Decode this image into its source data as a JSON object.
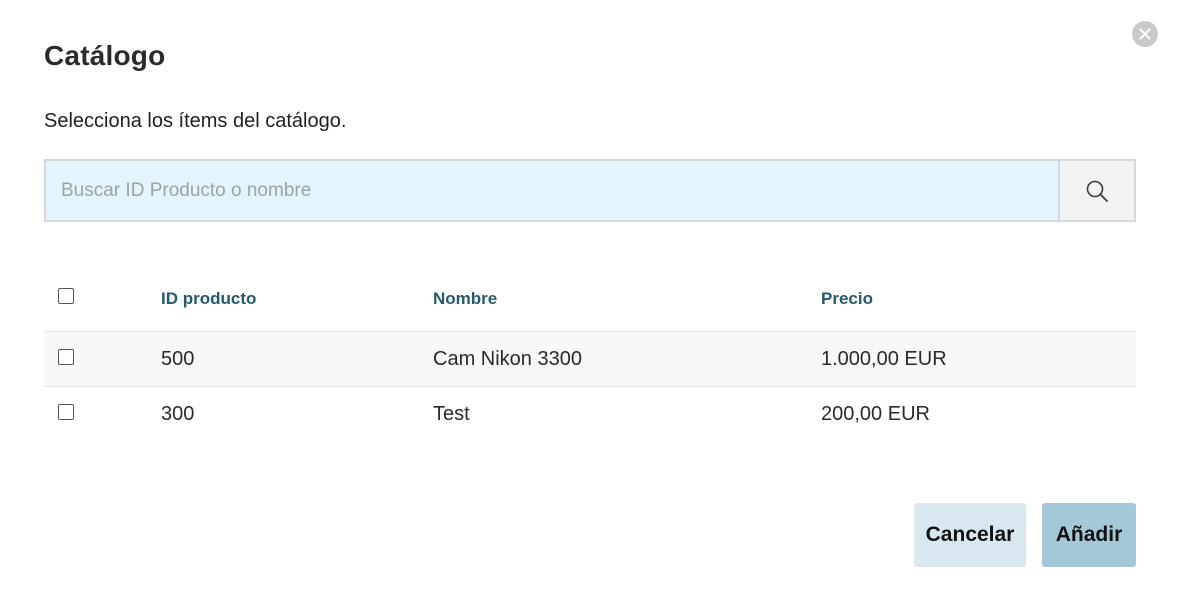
{
  "dialog": {
    "title": "Catálogo",
    "subtitle": "Selecciona los ítems del catálogo."
  },
  "search": {
    "placeholder": "Buscar ID Producto o nombre",
    "value": "",
    "icon": "search-icon"
  },
  "close": {
    "icon": "close-icon"
  },
  "table": {
    "columns": [
      "ID producto",
      "Nombre",
      "Precio"
    ],
    "rows": [
      {
        "id": "500",
        "name": "Cam Nikon 3300",
        "price": "1.000,00 EUR"
      },
      {
        "id": "300",
        "name": "Test",
        "price": "200,00 EUR"
      }
    ]
  },
  "buttons": {
    "cancel": "Cancelar",
    "add": "Añadir"
  },
  "colors": {
    "header_text": "#245a70",
    "search_bg": "#e4f4fc",
    "cancel_bg": "#d9e8ef",
    "add_bg": "#a5c8d8"
  }
}
